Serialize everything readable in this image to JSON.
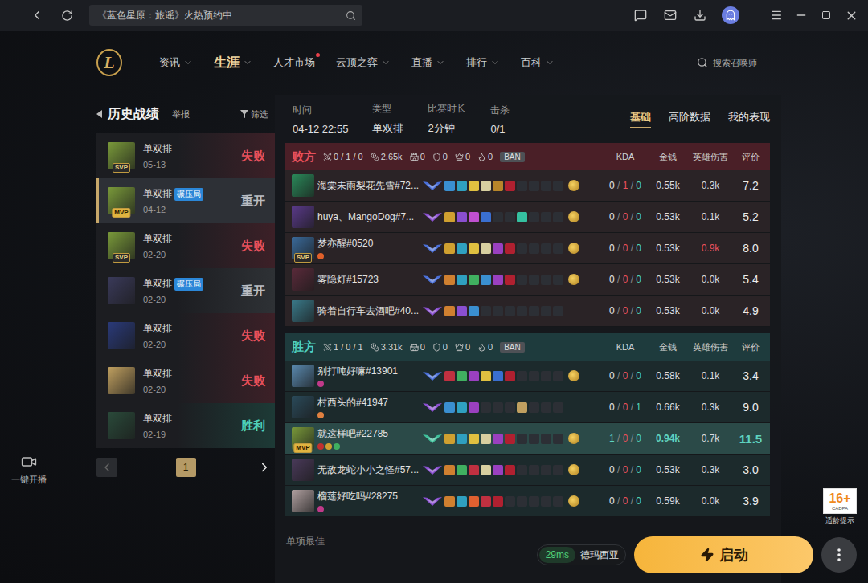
{
  "top_bar": {
    "search_text": "《蓝色星原：旅谣》火热预约中"
  },
  "nav": {
    "logo": "L",
    "items": [
      {
        "label": "资讯",
        "selected": false,
        "dropdown": true,
        "dot": false
      },
      {
        "label": "生涯",
        "selected": true,
        "dropdown": true,
        "dot": false
      },
      {
        "label": "人才市场",
        "selected": false,
        "dropdown": false,
        "dot": true
      },
      {
        "label": "云顶之弈",
        "selected": false,
        "dropdown": true,
        "dot": false
      },
      {
        "label": "直播",
        "selected": false,
        "dropdown": true,
        "dot": false
      },
      {
        "label": "排行",
        "selected": false,
        "dropdown": true,
        "dot": false
      },
      {
        "label": "百科",
        "selected": false,
        "dropdown": true,
        "dot": false
      }
    ],
    "search_placeholder": "搜索召唤师"
  },
  "side": {
    "stream_label": "一键开播"
  },
  "history": {
    "title": "历史战绩",
    "report": "举报",
    "filter": "筛选",
    "matches": [
      {
        "mode": "单双排",
        "tag": "",
        "badge": "SVP",
        "date": "05-13",
        "result": "失败",
        "kind": "lose",
        "selected": false,
        "color": "#7a9a3a"
      },
      {
        "mode": "单双排",
        "tag": "碾压局",
        "badge": "MVP",
        "date": "04-12",
        "result": "重开",
        "kind": "remake",
        "selected": true,
        "color": "#7a9a3a"
      },
      {
        "mode": "单双排",
        "tag": "",
        "badge": "SVP",
        "date": "02-20",
        "result": "失败",
        "kind": "lose",
        "selected": false,
        "color": "#7a9a3a"
      },
      {
        "mode": "单双排",
        "tag": "碾压局",
        "badge": "",
        "date": "02-20",
        "result": "重开",
        "kind": "remake",
        "selected": false,
        "color": "#3a3a5a"
      },
      {
        "mode": "单双排",
        "tag": "",
        "badge": "",
        "date": "02-20",
        "result": "失败",
        "kind": "lose",
        "selected": false,
        "color": "#2a3a7a"
      },
      {
        "mode": "单双排",
        "tag": "",
        "badge": "",
        "date": "02-20",
        "result": "失败",
        "kind": "lose",
        "selected": false,
        "color": "#c0a060"
      },
      {
        "mode": "单双排",
        "tag": "",
        "badge": "",
        "date": "02-19",
        "result": "胜利",
        "kind": "win",
        "selected": false,
        "color": "#2a4a3a"
      }
    ],
    "pages": [
      {
        "label": "1",
        "selected": true
      }
    ]
  },
  "match": {
    "info": [
      {
        "label": "时间",
        "value": "04-12 22:55"
      },
      {
        "label": "类型",
        "value": "单双排"
      },
      {
        "label": "比赛时长",
        "value": "2分钟"
      },
      {
        "label": "击杀",
        "value": "0/1"
      }
    ],
    "tabs": [
      {
        "label": "基础",
        "selected": true
      },
      {
        "label": "高阶数据",
        "selected": false
      },
      {
        "label": "我的表现",
        "selected": false
      }
    ],
    "teams": [
      {
        "name": "败方",
        "kind": "lose",
        "ban": "BAN",
        "columns": [
          "KDA",
          "金钱",
          "英雄伤害",
          "评价"
        ],
        "stats": [
          {
            "kind": "kda",
            "value": "0 / 1 / 0"
          },
          {
            "kind": "gold",
            "value": "2.65k"
          },
          {
            "kind": "tower",
            "value": "0"
          },
          {
            "kind": "inhibitor",
            "value": "0"
          },
          {
            "kind": "baron",
            "value": "0"
          },
          {
            "kind": "dragon",
            "value": "0"
          }
        ],
        "players": [
          {
            "name": "海棠未雨梨花先雪#72...",
            "badge": "",
            "color": "#2a8a5a",
            "rank_color": "#4a6fd8",
            "marks": [],
            "items": [
              "#3a8fd0",
              "#2fa0c0",
              "#e0c040",
              "#d8cfa0",
              "#b8862a",
              "#b02030",
              "",
              "",
              "",
              ""
            ],
            "trinket": true,
            "kda": "0 / 1 / 0",
            "gold": "0.55k",
            "damage": "0.3k",
            "damage_high": false,
            "rating": "7.2",
            "selected": false
          },
          {
            "name": "huya、MangoDog#7...",
            "badge": "",
            "color": "#5a3a8a",
            "rank_color": "#8a4fd0",
            "marks": [],
            "items": [
              "#d0a030",
              "#8a4fd0",
              "#c050d0",
              "#3a6fd0",
              "",
              "",
              "#35c0a0",
              "",
              "",
              ""
            ],
            "trinket": true,
            "kda": "0 / 0 / 0",
            "gold": "0.53k",
            "damage": "0.1k",
            "damage_high": false,
            "rating": "5.2",
            "selected": false
          },
          {
            "name": "梦亦醒#0520",
            "badge": "SVP",
            "color": "#3a6a9a",
            "rank_color": "#4a6fd8",
            "marks": [
              "#e0602a"
            ],
            "items": [
              "#d0a030",
              "#2fa0c0",
              "#e0c040",
              "#d8cfa0",
              "#9a40c0",
              "#b02030",
              "",
              "",
              "",
              ""
            ],
            "trinket": true,
            "kda": "0 / 0 / 0",
            "gold": "0.53k",
            "damage": "0.9k",
            "damage_high": true,
            "rating": "8.0",
            "selected": false
          },
          {
            "name": "雾隐灯#15723",
            "badge": "",
            "color": "#5a2a3a",
            "rank_color": "#4a6fd8",
            "marks": [],
            "items": [
              "#d08030",
              "#2fa0c0",
              "#40b060",
              "#3a8fd0",
              "#9a40c0",
              "#b02030",
              "",
              "",
              "",
              ""
            ],
            "trinket": true,
            "kda": "0 / 0 / 0",
            "gold": "0.53k",
            "damage": "0.0k",
            "damage_high": false,
            "rating": "5.4",
            "selected": false
          },
          {
            "name": "骑着自行车去酒吧#40...",
            "badge": "",
            "color": "#3a7a8a",
            "rank_color": "#8a4fd0",
            "marks": [],
            "items": [
              "#d08030",
              "#8a4fd0",
              "#3a8fd0",
              "",
              "",
              "",
              "",
              "",
              "",
              ""
            ],
            "trinket": false,
            "kda": "0 / 0 / 0",
            "gold": "0.53k",
            "damage": "0.0k",
            "damage_high": false,
            "rating": "4.9",
            "selected": false
          }
        ]
      },
      {
        "name": "胜方",
        "kind": "win",
        "ban": "BAN",
        "columns": [
          "KDA",
          "金钱",
          "英雄伤害",
          "评价"
        ],
        "stats": [
          {
            "kind": "kda",
            "value": "1 / 0 / 1"
          },
          {
            "kind": "gold",
            "value": "3.31k"
          },
          {
            "kind": "tower",
            "value": "0"
          },
          {
            "kind": "inhibitor",
            "value": "0"
          },
          {
            "kind": "baron",
            "value": "0"
          },
          {
            "kind": "dragon",
            "value": "0"
          }
        ],
        "players": [
          {
            "name": "别打吨好嘛#13901",
            "badge": "",
            "color": "#5a8ab0",
            "rank_color": "#4a6fd8",
            "marks": [
              "#c03a8a"
            ],
            "items": [
              "#c03040",
              "#40b060",
              "#9a40c0",
              "#e0c040",
              "#3a6fd0",
              "#b02030",
              "",
              "",
              "",
              ""
            ],
            "trinket": true,
            "kda": "0 / 0 / 0",
            "gold": "0.58k",
            "damage": "0.1k",
            "damage_high": false,
            "rating": "3.4",
            "selected": false
          },
          {
            "name": "村西头的#41947",
            "badge": "",
            "color": "#2a4a5a",
            "rank_color": "#8a4fd0",
            "marks": [
              "#e08040"
            ],
            "items": [
              "#3a8fd0",
              "#2fa0c0",
              "#9a40c0",
              "",
              "",
              "",
              "#c0a060",
              "",
              "",
              ""
            ],
            "trinket": false,
            "kda": "0 / 0 / 1",
            "gold": "0.66k",
            "damage": "0.3k",
            "damage_high": false,
            "rating": "9.0",
            "selected": false
          },
          {
            "name": "就这样吧#22785",
            "badge": "MVP",
            "color": "#7a9a3a",
            "rank_color": "#3fbf9a",
            "marks": [
              "#c03030",
              "#d0a030",
              "#40b060"
            ],
            "items": [
              "#d0a030",
              "#2fa0c0",
              "#e0c040",
              "#d8cfa0",
              "#9a40c0",
              "#b02030",
              "",
              "",
              "",
              ""
            ],
            "trinket": true,
            "kda": "1 / 0 / 0",
            "gold": "0.94k",
            "damage": "0.7k",
            "damage_high": false,
            "rating": "11.5",
            "selected": true
          },
          {
            "name": "无敌龙蛇小小之怪#57...",
            "badge": "",
            "color": "#4a3a5a",
            "rank_color": "#8a4fd0",
            "marks": [],
            "items": [
              "#d08030",
              "#40b060",
              "#c03040",
              "#d8cfa0",
              "#9a40c0",
              "#b02030",
              "",
              "",
              "",
              ""
            ],
            "trinket": true,
            "kda": "0 / 0 / 0",
            "gold": "0.53k",
            "damage": "0.3k",
            "damage_high": false,
            "rating": "3.0",
            "selected": false
          },
          {
            "name": "榴莲好吃吗#28275",
            "badge": "",
            "color": "#b0a0a0",
            "rank_color": "#8a4fd0",
            "marks": [
              "#c03a8a"
            ],
            "items": [
              "#d08030",
              "#2fa0c0",
              "#e06030",
              "#c03040",
              "#b02030",
              "",
              "",
              "",
              "",
              ""
            ],
            "trinket": true,
            "kda": "0 / 0 / 0",
            "gold": "0.59k",
            "damage": "0.0k",
            "damage_high": false,
            "rating": "3.9",
            "selected": false
          }
        ]
      }
    ],
    "section_title": "单项最佳"
  },
  "launch": {
    "ping": "29ms",
    "server": "德玛西亚",
    "button": "启动"
  },
  "age_badge": {
    "rating": "16+",
    "org": "CADPA",
    "label": "适龄提示"
  }
}
